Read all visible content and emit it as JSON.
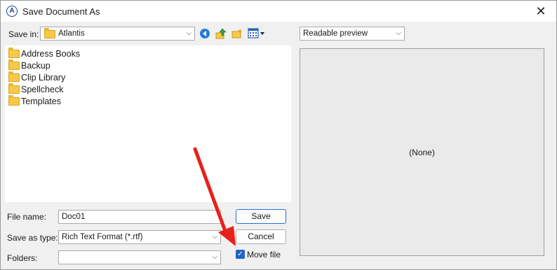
{
  "window": {
    "title": "Save Document As",
    "close_glyph": "✕",
    "app_icon_glyph": "A"
  },
  "save_in": {
    "label": "Save in:",
    "value": "Atlantis"
  },
  "toolbar": {
    "back_icon": "back-icon",
    "up_icon": "up-one-level-icon",
    "new_folder_icon": "new-folder-icon",
    "views_icon": "view-menu-icon"
  },
  "files": [
    {
      "name": "Address Books"
    },
    {
      "name": "Backup"
    },
    {
      "name": "Clip Library"
    },
    {
      "name": "Spellcheck"
    },
    {
      "name": "Templates"
    }
  ],
  "file_name": {
    "label": "File name:",
    "value": "Doc01"
  },
  "save_as_type": {
    "label": "Save as type:",
    "value": "Rich Text Format (*.rtf)"
  },
  "folders": {
    "label": "Folders:",
    "value": ""
  },
  "buttons": {
    "save": "Save",
    "cancel": "Cancel"
  },
  "move_file": {
    "label": "Move file",
    "checked": true
  },
  "preview": {
    "mode": "Readable preview",
    "content": "(None)"
  },
  "colors": {
    "accent": "#2164c8",
    "annotation_arrow": "#e8201c"
  }
}
